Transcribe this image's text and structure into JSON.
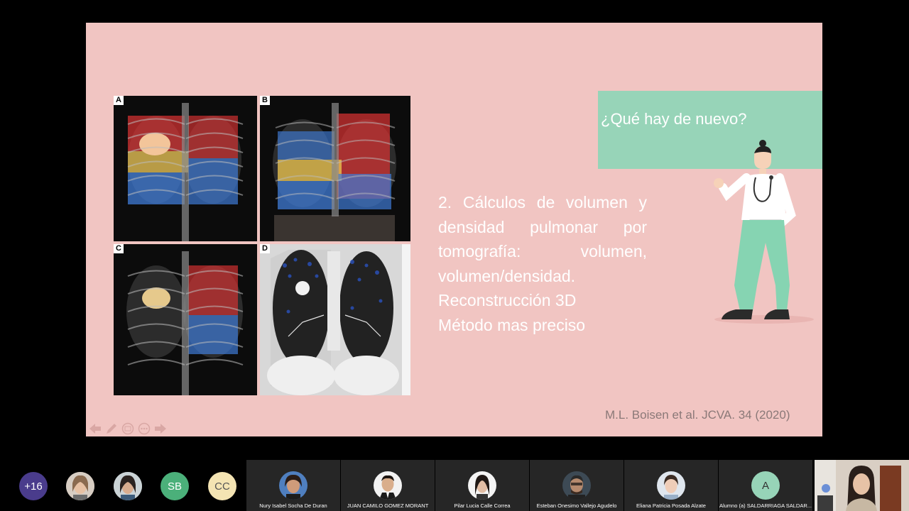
{
  "slide": {
    "banner_title": "¿Qué hay de nuevo?",
    "body_lines": [
      "2. Cálculos de volumen y",
      "densidad pulmonar por",
      "tomografía: volumen,",
      "volumen/densidad.",
      "Reconstrucción 3D",
      "Método mas preciso"
    ],
    "body_lines_justified": [
      [
        "2.",
        "Cálculos",
        "de",
        "volumen",
        "y"
      ],
      [
        "densidad",
        "pulmonar",
        "por"
      ],
      [
        "tomografía:",
        "volumen,"
      ]
    ],
    "citation": "M.L. Boisen et al. JCVA. 34 (2020)",
    "panel_labels": [
      "A",
      "B",
      "C",
      "D"
    ]
  },
  "participants": {
    "overflow_count": "+16",
    "initials": [
      {
        "text": "SB",
        "color": "#4bb07a"
      },
      {
        "text": "CC",
        "color": "#f4e4b3"
      }
    ],
    "tiles": [
      {
        "name": "Nury Isabel Socha De Duran"
      },
      {
        "name": "JUAN CAMILO GOMEZ MORANT"
      },
      {
        "name": "Pilar Lucia Calle Correa"
      },
      {
        "name": "Esteban Onesimo Vallejo Agudelo"
      },
      {
        "name": "Eliana Patricia Posada Alzate"
      },
      {
        "name": "Alumno (a)  SALDARRIAGA SALDAR...",
        "initial": "A"
      }
    ]
  },
  "colors": {
    "slide_bg": "#f1c5c2",
    "banner": "#97d4b8",
    "text_white": "#ffffff",
    "citation": "#8b7978"
  }
}
